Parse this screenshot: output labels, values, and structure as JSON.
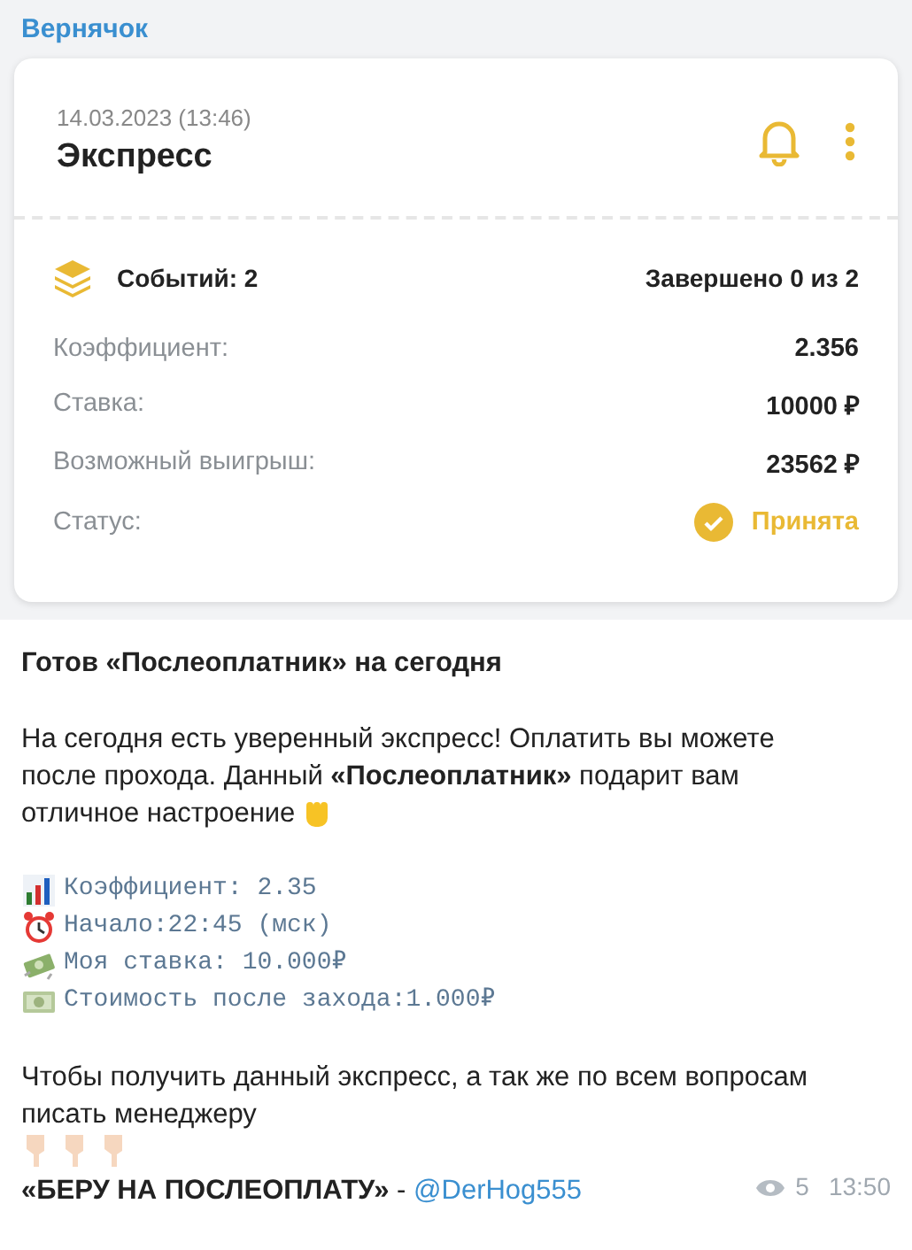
{
  "channel": "Вернячок",
  "card": {
    "date": "14.03.2023 (13:46)",
    "title": "Экспресс",
    "events": "Событий: 2",
    "completed": "Завершено 0 из 2",
    "rows": [
      {
        "label": "Коэффициент:",
        "value": "2.356",
        "kind": "text"
      },
      {
        "label": "Ставка:",
        "value": "10000 ₽",
        "kind": "text"
      },
      {
        "label": "Возможный выигрыш:",
        "value": "23562 ₽",
        "kind": "text"
      },
      {
        "label": "Статус:",
        "value": "Принята",
        "kind": "status"
      }
    ]
  },
  "message": {
    "heading": "Готов «Послеоплатник» на сегодня",
    "paragraph": "На сегодня есть уверенный экспресс! Оплатить вы можете после прохода. Данный **«Послеоплатник»** подарит вам отличное настроение",
    "details": [
      {
        "kind": "chart",
        "text": "Коэффициент: 2.35"
      },
      {
        "kind": "clock",
        "text": "Начало:22:45 (мск)"
      },
      {
        "kind": "money",
        "text": "Моя ставка: 10.000₽"
      },
      {
        "kind": "bill",
        "text": "Стоимость после захода:1.000₽"
      }
    ],
    "contact": "Чтобы получить данный экспресс, а так же по всем вопросам писать менеджеру",
    "cta": "**«БЕРУ НА ПОСЛЕОПЛАТУ»** - ",
    "link": "@DerHog555",
    "views": "5",
    "time": "13:50"
  }
}
